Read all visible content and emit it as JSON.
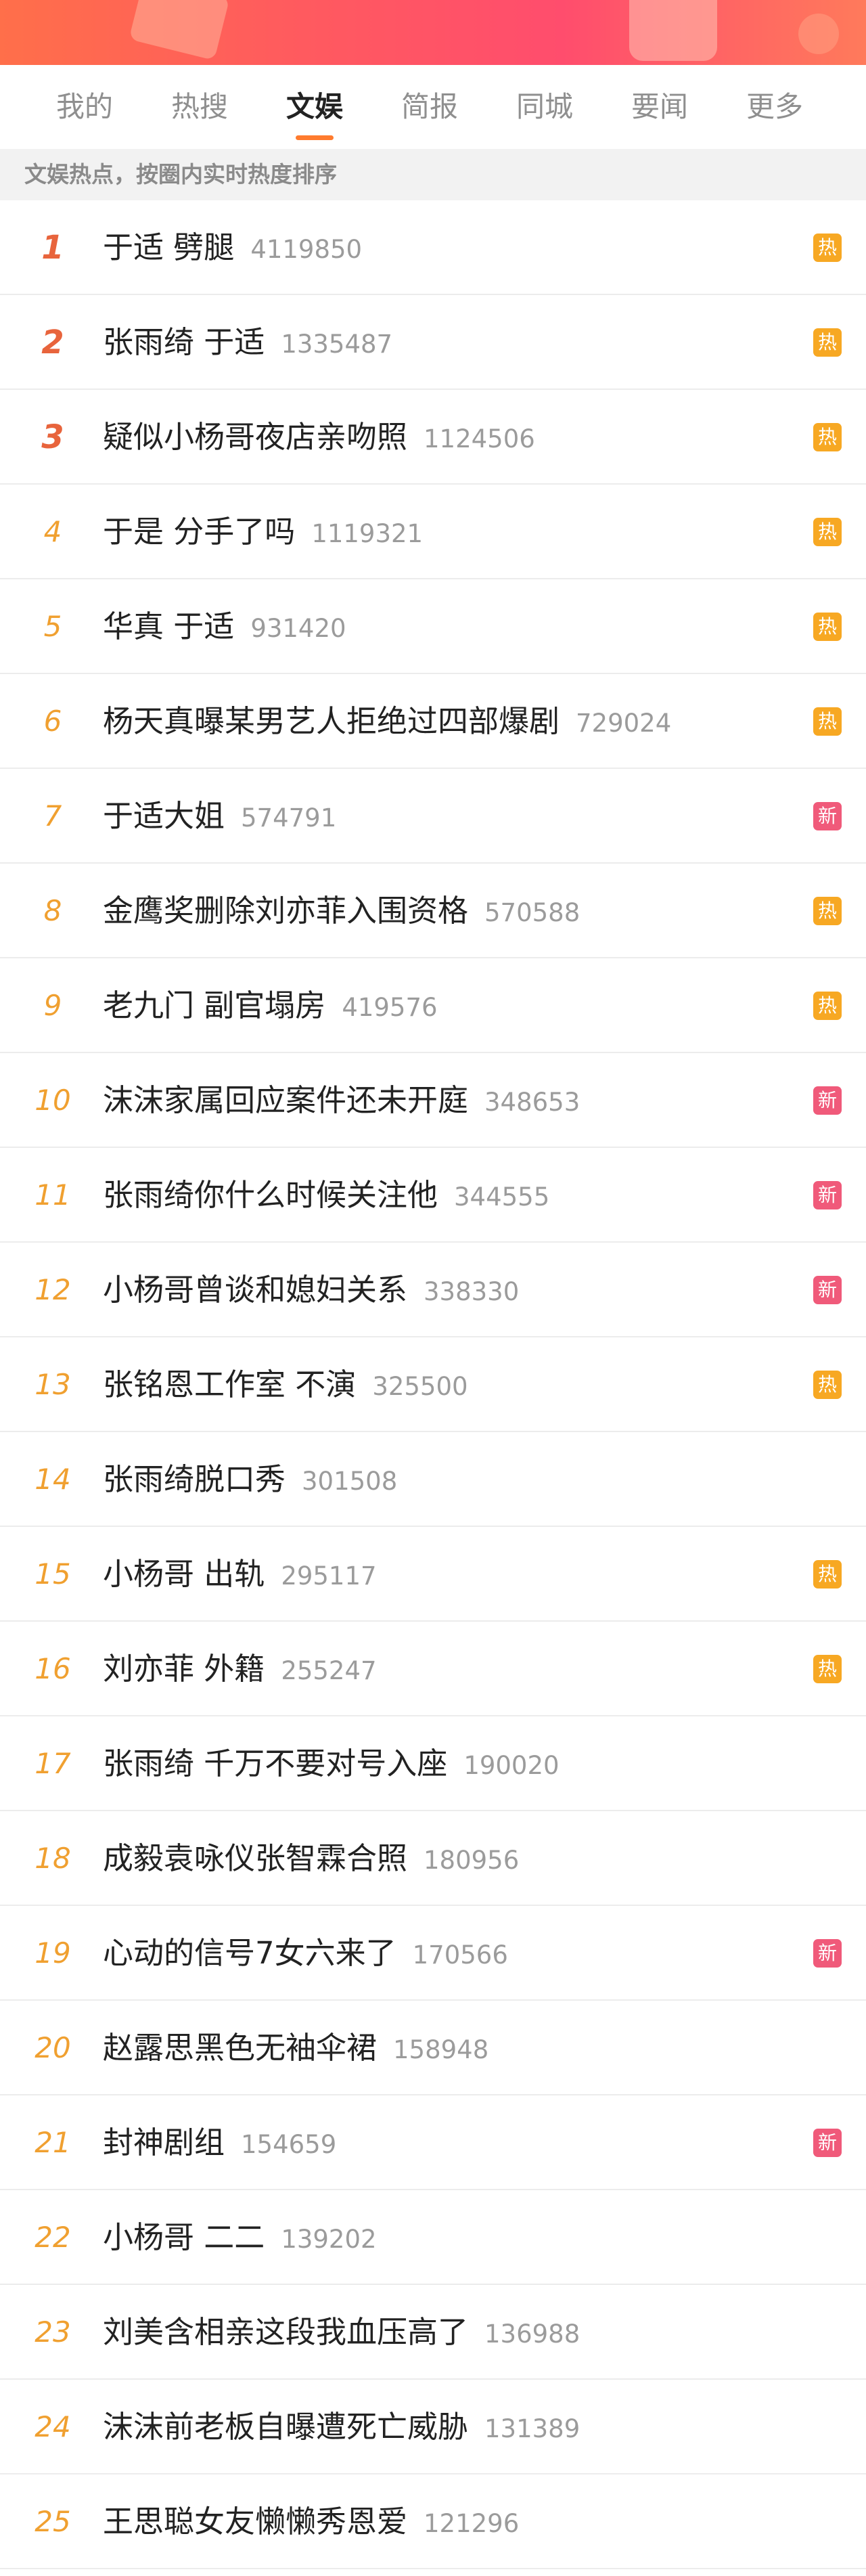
{
  "colors": {
    "accent": "#ff7b2e",
    "hot_badge": "#f7a823",
    "new_badge": "#f05a7a",
    "rank_top": "#e8643c",
    "rank_normal": "#f0a030"
  },
  "tabs": [
    {
      "label": "我的",
      "active": false
    },
    {
      "label": "热搜",
      "active": false
    },
    {
      "label": "文娱",
      "active": true
    },
    {
      "label": "简报",
      "active": false
    },
    {
      "label": "同城",
      "active": false
    },
    {
      "label": "要闻",
      "active": false
    },
    {
      "label": "更多",
      "active": false
    }
  ],
  "subheader": "文娱热点，按圈内实时热度排序",
  "items": [
    {
      "rank": "1",
      "title": "于适 劈腿",
      "count": "4119850",
      "badge": "热"
    },
    {
      "rank": "2",
      "title": "张雨绮 于适",
      "count": "1335487",
      "badge": "热"
    },
    {
      "rank": "3",
      "title": "疑似小杨哥夜店亲吻照",
      "count": "1124506",
      "badge": "热"
    },
    {
      "rank": "4",
      "title": "于是 分手了吗",
      "count": "1119321",
      "badge": "热"
    },
    {
      "rank": "5",
      "title": "华真 于适",
      "count": "931420",
      "badge": "热"
    },
    {
      "rank": "6",
      "title": "杨天真曝某男艺人拒绝过四部爆剧",
      "count": "729024",
      "badge": "热"
    },
    {
      "rank": "7",
      "title": "于适大姐",
      "count": "574791",
      "badge": "新"
    },
    {
      "rank": "8",
      "title": "金鹰奖删除刘亦菲入围资格",
      "count": "570588",
      "badge": "热"
    },
    {
      "rank": "9",
      "title": "老九门 副官塌房",
      "count": "419576",
      "badge": "热"
    },
    {
      "rank": "10",
      "title": "沫沫家属回应案件还未开庭",
      "count": "348653",
      "badge": "新"
    },
    {
      "rank": "11",
      "title": "张雨绮你什么时候关注他",
      "count": "344555",
      "badge": "新"
    },
    {
      "rank": "12",
      "title": "小杨哥曾谈和媳妇关系",
      "count": "338330",
      "badge": "新"
    },
    {
      "rank": "13",
      "title": "张铭恩工作室 不演",
      "count": "325500",
      "badge": "热"
    },
    {
      "rank": "14",
      "title": "张雨绮脱口秀",
      "count": "301508",
      "badge": ""
    },
    {
      "rank": "15",
      "title": "小杨哥 出轨",
      "count": "295117",
      "badge": "热"
    },
    {
      "rank": "16",
      "title": "刘亦菲 外籍",
      "count": "255247",
      "badge": "热"
    },
    {
      "rank": "17",
      "title": "张雨绮 千万不要对号入座",
      "count": "190020",
      "badge": ""
    },
    {
      "rank": "18",
      "title": "成毅袁咏仪张智霖合照",
      "count": "180956",
      "badge": ""
    },
    {
      "rank": "19",
      "title": "心动的信号7女六来了",
      "count": "170566",
      "badge": "新"
    },
    {
      "rank": "20",
      "title": "赵露思黑色无袖伞裙",
      "count": "158948",
      "badge": ""
    },
    {
      "rank": "21",
      "title": "封神剧组",
      "count": "154659",
      "badge": "新"
    },
    {
      "rank": "22",
      "title": "小杨哥 二二",
      "count": "139202",
      "badge": ""
    },
    {
      "rank": "23",
      "title": "刘美含相亲这段我血压高了",
      "count": "136988",
      "badge": ""
    },
    {
      "rank": "24",
      "title": "沫沫前老板自曝遭死亡威胁",
      "count": "131389",
      "badge": ""
    },
    {
      "rank": "25",
      "title": "王思聪女友懒懒秀恩爱",
      "count": "121296",
      "badge": ""
    }
  ]
}
